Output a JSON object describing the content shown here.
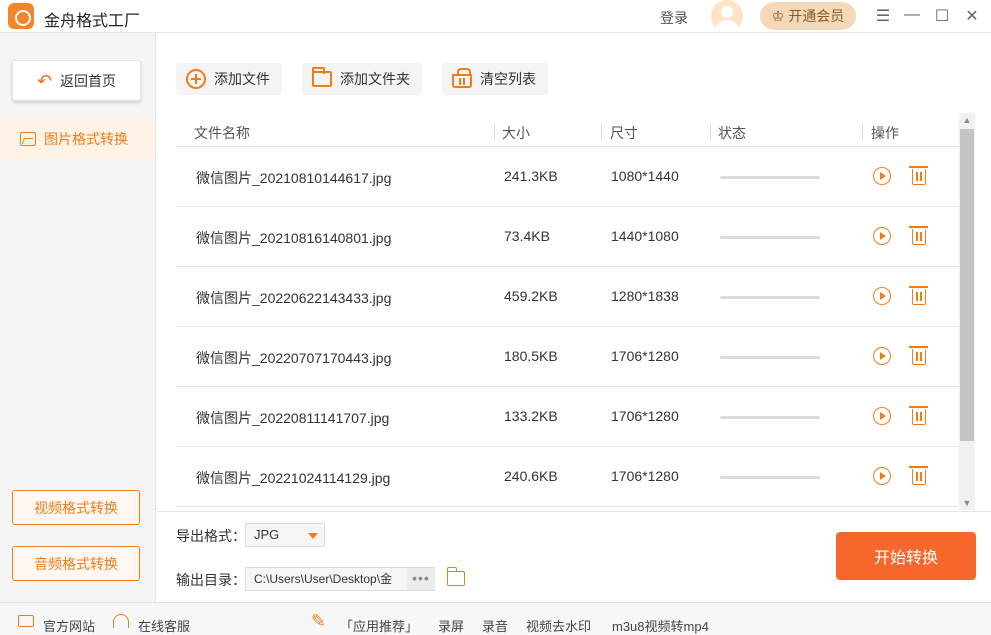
{
  "app": {
    "title": "金舟格式工厂"
  },
  "header": {
    "login_label": "登录",
    "vip_label": "开通会员"
  },
  "sidebar": {
    "back_label": "返回首页",
    "active_item": "图片格式转换",
    "video_btn": "视频格式转换",
    "audio_btn": "音频格式转换"
  },
  "toolbar": {
    "add_file": "添加文件",
    "add_folder": "添加文件夹",
    "clear_list": "清空列表"
  },
  "table": {
    "headers": {
      "name": "文件名称",
      "size": "大小",
      "dimensions": "尺寸",
      "status": "状态",
      "actions": "操作"
    },
    "rows": [
      {
        "name": "微信图片_20210810144617.jpg",
        "size": "241.3KB",
        "dimensions": "1080*1440"
      },
      {
        "name": "微信图片_20210816140801.jpg",
        "size": "73.4KB",
        "dimensions": "1440*1080"
      },
      {
        "name": "微信图片_20220622143433.jpg",
        "size": "459.2KB",
        "dimensions": "1280*1838"
      },
      {
        "name": "微信图片_20220707170443.jpg",
        "size": "180.5KB",
        "dimensions": "1706*1280"
      },
      {
        "name": "微信图片_20220811141707.jpg",
        "size": "133.2KB",
        "dimensions": "1706*1280"
      },
      {
        "name": "微信图片_20221024114129.jpg",
        "size": "240.6KB",
        "dimensions": "1706*1280"
      }
    ]
  },
  "output": {
    "format_label": "导出格式：",
    "format_value": "JPG",
    "dir_label": "输出目录：",
    "dir_value": "C:\\Users\\User\\Desktop\\金",
    "more": "•••",
    "start_label": "开始转换"
  },
  "footer": {
    "website": "官方网站",
    "support": "在线客服",
    "recommend": "「应用推荐」",
    "screen_record": "录屏",
    "audio_record": "录音",
    "watermark": "视频去水印",
    "m3u8": "m3u8视频转mp4"
  },
  "colors": {
    "accent": "#f07d1a",
    "start_button": "#f5672a",
    "vip_bg": "#f3d9b8"
  }
}
